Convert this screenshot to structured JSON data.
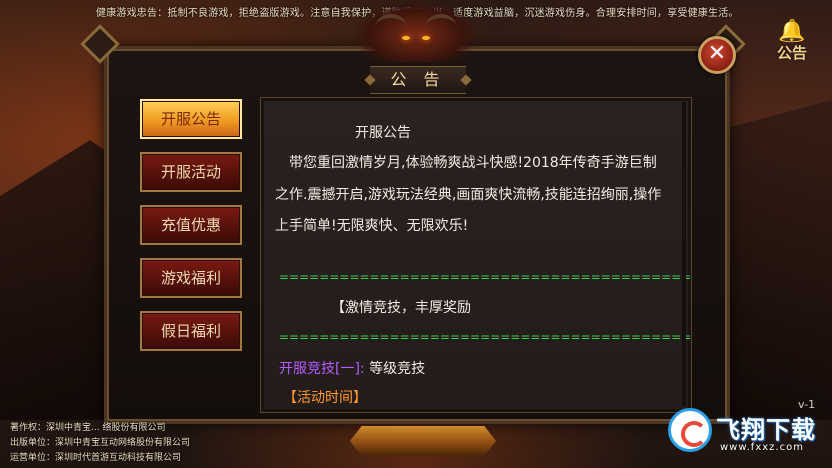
{
  "health_notice": "健康游戏忠告：抵制不良游戏，拒绝盗版游戏。注意自我保护，谨防受骗上当。适度游戏益脑，沉迷游戏伤身。合理安排时间，享受健康生活。",
  "panel": {
    "title": "公 告",
    "close_symbol": "✕"
  },
  "notice_button": {
    "icon": "bell-icon",
    "label": "公告"
  },
  "tabs": [
    {
      "label": "开服公告",
      "active": true
    },
    {
      "label": "开服活动",
      "active": false
    },
    {
      "label": "充值优惠",
      "active": false
    },
    {
      "label": "游戏福利",
      "active": false
    },
    {
      "label": "假日福利",
      "active": false
    }
  ],
  "content": {
    "title": "开服公告",
    "p1": "带您重回激情岁月,体验畅爽战斗快感!2018年传奇手游巨制",
    "p2": "之作.震撼开启,游戏玩法经典,画面爽快流畅,技能连招绚丽,操作",
    "p3": "上手简单!无限爽快、无限欢乐!",
    "divider": "=================================================",
    "section_heading": "【激情竞技，丰厚奖励",
    "sub_key": "开服竞技[一]:",
    "sub_value": "等级竞技",
    "time_label": "【活动时间】"
  },
  "footer": {
    "copyright": "著作权：深圳中青宝... 络股份有限公司",
    "publisher": "出版单位：深圳中青宝互动网络股份有限公司",
    "operator": "运营单位：深圳时代首游互动科技有限公司"
  },
  "version": "v-1",
  "watermark": {
    "text": "飞翔下载",
    "url": "www.fxxz.com"
  },
  "colors": {
    "accent_gold": "#f09a20",
    "tab_red": "#7a1a12",
    "divider_green": "#39d050",
    "highlight_purple": "#b45cff",
    "time_orange": "#ff9a2a"
  }
}
